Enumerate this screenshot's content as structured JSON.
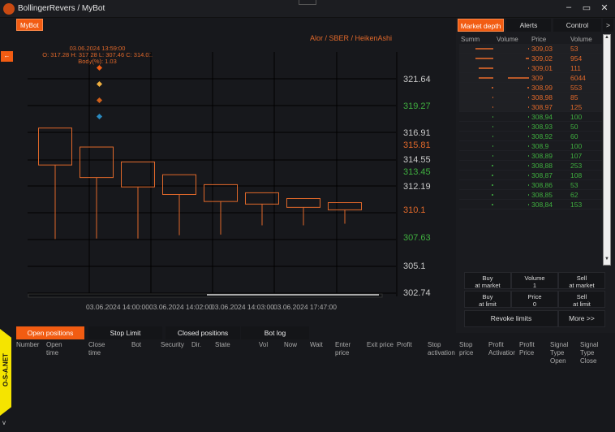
{
  "window": {
    "title": "BollingerRevers / MyBot",
    "minimize": "–",
    "maximize": "▭",
    "close": "✕"
  },
  "bot_tab": "MyBot",
  "collapse_button": "←",
  "chart": {
    "source": "Alor / SBER / HeikenAshi",
    "tooltip": {
      "date": "03.06.2024 13:59:00",
      "ohlc": "O: 317.28 H: 317.28 L: 307.46 C: 314.01",
      "body": "Body(%): 1.03"
    },
    "colors": {
      "down": "#e0682a",
      "grid": "#000000",
      "ask": "#e0682a",
      "bid": "#3fae3f"
    }
  },
  "chart_data": {
    "type": "candlestick",
    "style": "heiken-ashi hollow",
    "y_ticks": [
      {
        "label": "321.64",
        "color": "#c8c8c8"
      },
      {
        "label": "319.27",
        "color": "#3fae3f"
      },
      {
        "label": "316.91",
        "color": "#c8c8c8"
      },
      {
        "label": "315.81",
        "color": "#e0682a"
      },
      {
        "label": "314.55",
        "color": "#c8c8c8"
      },
      {
        "label": "313.45",
        "color": "#3fae3f"
      },
      {
        "label": "312.19",
        "color": "#c8c8c8"
      },
      {
        "label": "310.1",
        "color": "#e0682a"
      },
      {
        "label": "307.63",
        "color": "#3fae3f"
      },
      {
        "label": "305.1",
        "color": "#c8c8c8"
      },
      {
        "label": "302.74",
        "color": "#c8c8c8"
      }
    ],
    "ylim": [
      302.74,
      321.64
    ],
    "x_labels": [
      "03.06.2024 14:00:00",
      "03.06.2024 14:02:00",
      "03.06.2024 14:03:00",
      "03.06.2024 17:47:00"
    ],
    "candles": [
      {
        "o": 317.28,
        "h": 317.28,
        "l": 307.46,
        "c": 314.01
      },
      {
        "o": 315.6,
        "h": 315.6,
        "l": 307.5,
        "c": 312.9
      },
      {
        "o": 314.28,
        "h": 314.28,
        "l": 307.5,
        "c": 312.07
      },
      {
        "o": 313.15,
        "h": 313.15,
        "l": 307.8,
        "c": 311.4
      },
      {
        "o": 312.27,
        "h": 312.27,
        "l": 307.85,
        "c": 310.78
      },
      {
        "o": 311.55,
        "h": 311.55,
        "l": 308.67,
        "c": 310.55
      },
      {
        "o": 311.04,
        "h": 311.04,
        "l": 308.67,
        "c": 310.26
      },
      {
        "o": 310.68,
        "h": 310.68,
        "l": 308.81,
        "c": 310.04
      }
    ],
    "markers": {
      "candle": 2,
      "colors": [
        "#f25c12",
        "#f0b040",
        "#d0601a",
        "#2a8ac0"
      ]
    },
    "grid": true
  },
  "right_panel": {
    "tabs": [
      "Market depth",
      "Alerts",
      "Control",
      ">"
    ],
    "headers": [
      "Summ",
      "Volume",
      "Price",
      "Volume"
    ],
    "asks": [
      {
        "price": "309,03",
        "volume": "53"
      },
      {
        "price": "309,02",
        "volume": "954"
      },
      {
        "price": "309,01",
        "volume": "111"
      },
      {
        "price": "309",
        "volume": "6044"
      },
      {
        "price": "308,99",
        "volume": "553"
      },
      {
        "price": "308,98",
        "volume": "85"
      },
      {
        "price": "308,97",
        "volume": "125"
      }
    ],
    "bids": [
      {
        "price": "308,94",
        "volume": "100"
      },
      {
        "price": "308,93",
        "volume": "50"
      },
      {
        "price": "308,92",
        "volume": "60"
      },
      {
        "price": "308,9",
        "volume": "100"
      },
      {
        "price": "308,89",
        "volume": "107"
      },
      {
        "price": "308,88",
        "volume": "253"
      },
      {
        "price": "308,87",
        "volume": "108"
      },
      {
        "price": "308,86",
        "volume": "53"
      },
      {
        "price": "308,85",
        "volume": "62"
      },
      {
        "price": "308,84",
        "volume": "153"
      }
    ],
    "buy_market": [
      "Buy",
      "at market"
    ],
    "volume": [
      "Volume",
      "1"
    ],
    "sell_market": [
      "Sell",
      "at market"
    ],
    "buy_limit": [
      "Buy",
      "at limit"
    ],
    "price": [
      "Price",
      "0"
    ],
    "sell_limit": [
      "Sell",
      "at limit"
    ],
    "revoke": "Revoke limits",
    "more": "More >>"
  },
  "bottom": {
    "tabs": [
      "Open positions",
      "Stop Limit",
      "Closed positions",
      "Bot log"
    ],
    "columns": [
      "Number",
      "Open time",
      "Close time",
      "Bot",
      "Security",
      "Dir.",
      "State",
      "Vol",
      "Now",
      "Wait",
      "Enter price",
      "Exit price",
      "Profit",
      "Stop activation",
      "Stop price",
      "Profit Activatior",
      "Profit Price",
      "Signal Type Open",
      "Signal Type Close"
    ],
    "side_label": "O-S-A.NET",
    "expand": "v"
  }
}
